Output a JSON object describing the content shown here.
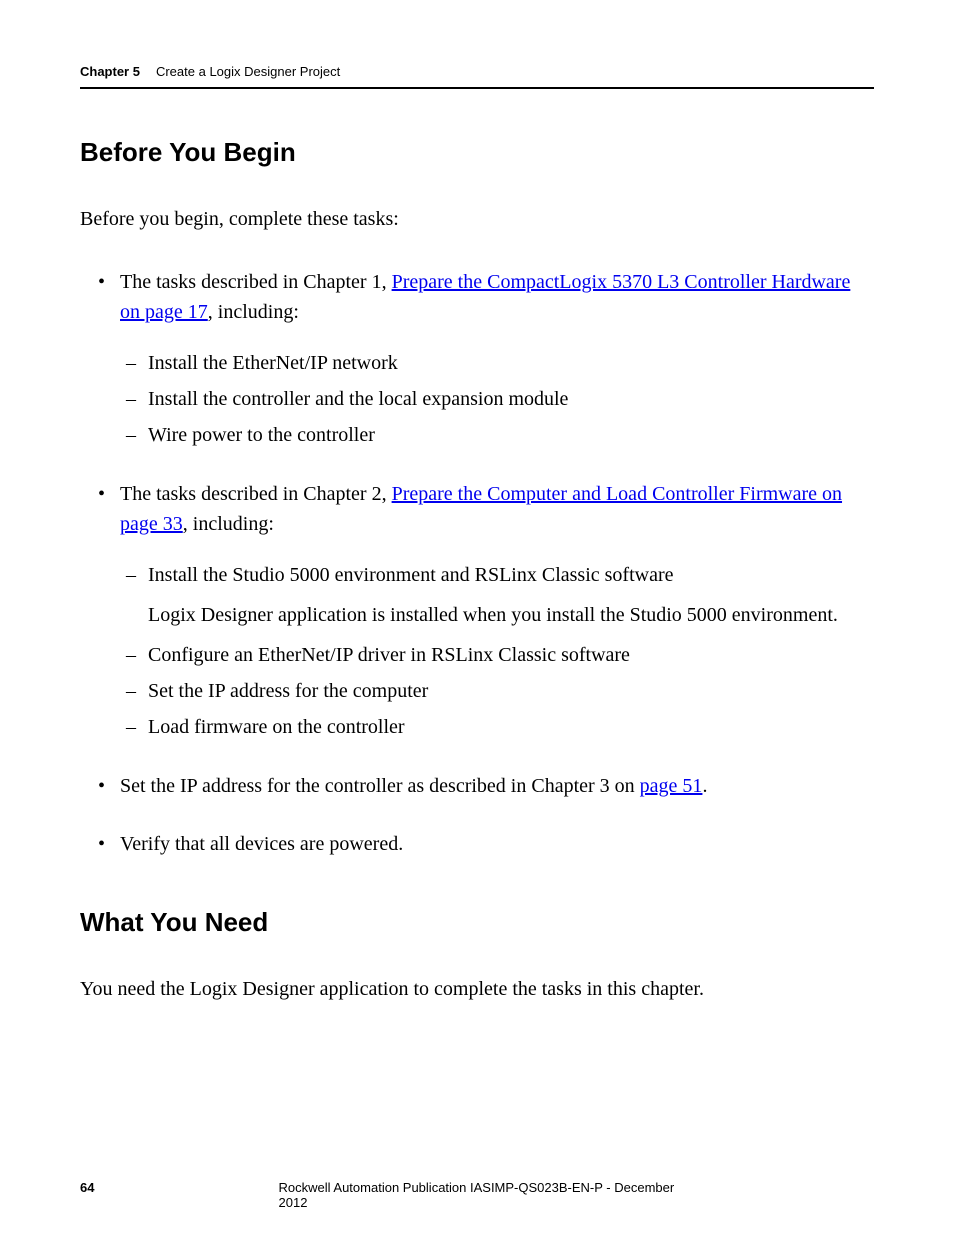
{
  "header": {
    "chapter_label": "Chapter 5",
    "chapter_title": "Create a Logix Designer Project"
  },
  "section1": {
    "heading": "Before You Begin",
    "intro": "Before you begin, complete these tasks:",
    "bullet1": {
      "pre": "The tasks described in Chapter 1, ",
      "link": "Prepare the CompactLogix 5370 L3 Controller Hardware on page 17",
      "post": ", including:",
      "subs": {
        "a": "Install the EtherNet/IP network",
        "b": "Install the controller and the local expansion module",
        "c": "Wire power to the controller"
      }
    },
    "bullet2": {
      "pre": "The tasks described in Chapter 2, ",
      "link": "Prepare the Computer and Load Controller Firmware on page 33",
      "post": ", including:",
      "subs": {
        "a": "Install the Studio 5000 environment and RSLinx Classic software",
        "a_note": "Logix Designer application is installed when you install the Studio 5000 environment.",
        "b": "Configure an EtherNet/IP driver in RSLinx Classic software",
        "c": "Set the IP address for the computer",
        "d": "Load firmware on the controller"
      }
    },
    "bullet3": {
      "pre": "Set the IP address for the controller as described in Chapter 3 on ",
      "link": "page 51",
      "post": "."
    },
    "bullet4": "Verify that all devices are powered."
  },
  "section2": {
    "heading": "What You Need",
    "body": "You need the Logix Designer application to complete the tasks in this chapter."
  },
  "footer": {
    "page_num": "64",
    "publication": "Rockwell Automation Publication IASIMP-QS023B-EN-P - December 2012"
  }
}
